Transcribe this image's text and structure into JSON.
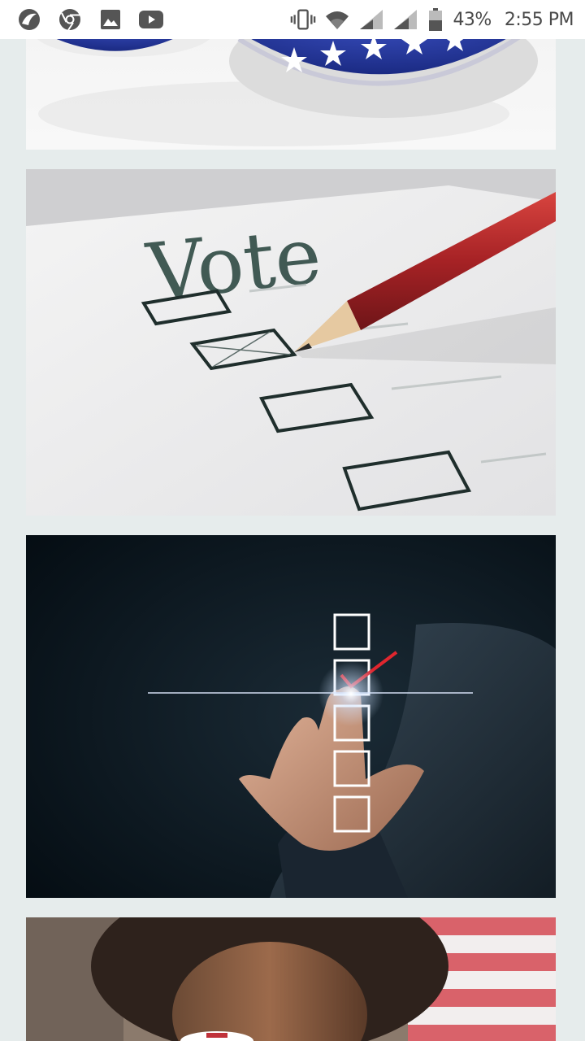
{
  "status_bar": {
    "battery_percent": "43%",
    "time": "2:55 PM",
    "left_icons": [
      "app-icon",
      "chrome-icon",
      "gallery-icon",
      "youtube-icon"
    ],
    "right_icons": [
      "vibrate-icon",
      "wifi-icon",
      "signal-icon",
      "signal-icon",
      "battery-icon"
    ]
  },
  "feed": {
    "images": [
      {
        "subject": "campaign-buttons-photo"
      },
      {
        "subject": "ballot-vote-photo",
        "ballot_heading": "Vote"
      },
      {
        "subject": "touchscreen-checklist-photo"
      },
      {
        "subject": "voter-sticker-photo"
      }
    ]
  },
  "colors": {
    "background": "#e6ecec",
    "status_bar": "#ffffff",
    "pencil_red": "#b3292c",
    "button_blue": "#22349a",
    "check_red": "#e0262e"
  }
}
